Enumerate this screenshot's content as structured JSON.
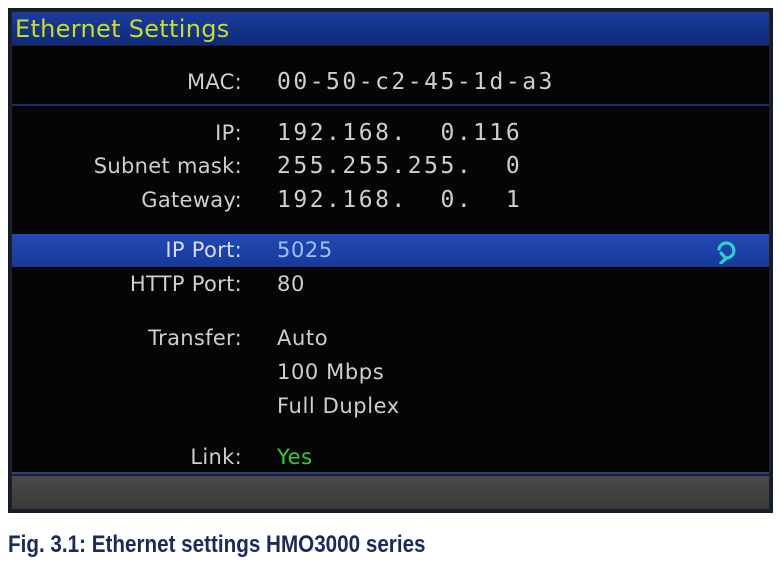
{
  "window": {
    "title": "Ethernet Settings"
  },
  "settings": {
    "mac": {
      "label": "MAC:",
      "value": "00-50-c2-45-1d-a3"
    },
    "ip": {
      "label": "IP:",
      "value": "192.168.  0.116"
    },
    "subnet": {
      "label": "Subnet mask:",
      "value": "255.255.255.  0"
    },
    "gateway": {
      "label": "Gateway:",
      "value": "192.168.  0.  1"
    },
    "ip_port": {
      "label": "IP Port:",
      "value": "5025"
    },
    "http_port": {
      "label": "HTTP Port:",
      "value": "80"
    },
    "transfer": {
      "label": "Transfer:",
      "values": [
        "Auto",
        "100 Mbps",
        "Full Duplex"
      ]
    },
    "link": {
      "label": "Link:",
      "value": "Yes"
    }
  },
  "icons": {
    "ip_port_action": "refresh-icon"
  },
  "colors": {
    "title_text": "#c8dc2a",
    "selection": "#2249b4",
    "link_status": "#2fcf3a"
  },
  "caption": "Fig. 3.1: Ethernet settings HMO3000 series"
}
